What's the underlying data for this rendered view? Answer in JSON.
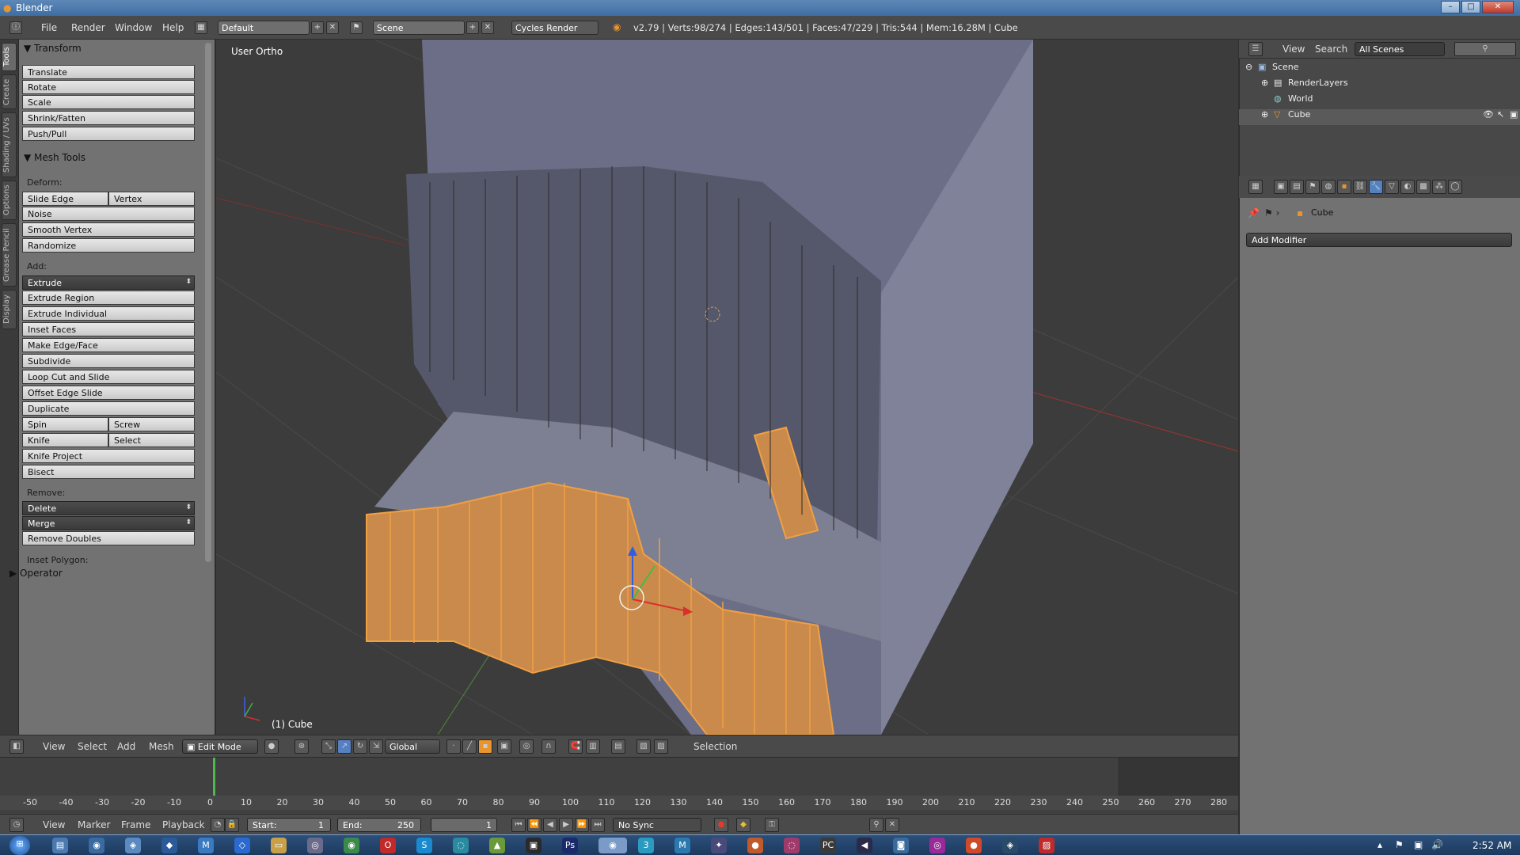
{
  "window": {
    "title": "Blender",
    "min": "–",
    "max": "□",
    "close": "✕"
  },
  "info_bar": {
    "menus": [
      "File",
      "Render",
      "Window",
      "Help"
    ],
    "layout": "Default",
    "scene": "Scene",
    "engine": "Cycles Render",
    "stats": "v2.79 | Verts:98/274 | Edges:143/501 | Faces:47/229 | Tris:544 | Mem:16.28M | Cube"
  },
  "shelf_tabs": [
    "Tools",
    "Create",
    "Shading / UVs",
    "Options",
    "Grease Pencil",
    "Display"
  ],
  "tool_shelf": {
    "transform_title": "Transform",
    "transform": [
      "Translate",
      "Rotate",
      "Scale",
      "Shrink/Fatten",
      "Push/Pull"
    ],
    "mesh_tools_title": "Mesh Tools",
    "deform_label": "Deform:",
    "slide_edge": "Slide Edge",
    "vertex": "Vertex",
    "noise": "Noise",
    "smooth_vertex": "Smooth Vertex",
    "randomize": "Randomize",
    "add_label": "Add:",
    "extrude": "Extrude",
    "add_items": [
      "Extrude Region",
      "Extrude Individual",
      "Inset Faces",
      "Make Edge/Face",
      "Subdivide",
      "Loop Cut and Slide",
      "Offset Edge Slide",
      "Duplicate"
    ],
    "spin": "Spin",
    "screw": "Screw",
    "knife": "Knife",
    "select": "Select",
    "knife_project": "Knife Project",
    "bisect": "Bisect",
    "remove_label": "Remove:",
    "delete": "Delete",
    "merge": "Merge",
    "remove_doubles": "Remove Doubles",
    "inset_polygon": "Inset Polygon:",
    "operator": "Operator"
  },
  "viewport": {
    "view_label": "User Ortho",
    "object_label": "(1) Cube"
  },
  "view3d_header": {
    "menus": [
      "View",
      "Select",
      "Add",
      "Mesh"
    ],
    "mode": "Edit Mode",
    "orientation": "Global",
    "selection": "Selection"
  },
  "timeline": {
    "ticks": [
      "-50",
      "-40",
      "-30",
      "-20",
      "-10",
      "0",
      "10",
      "20",
      "30",
      "40",
      "50",
      "60",
      "70",
      "80",
      "90",
      "100",
      "110",
      "120",
      "130",
      "140",
      "150",
      "160",
      "170",
      "180",
      "190",
      "200",
      "210",
      "220",
      "230",
      "240",
      "250",
      "260",
      "270",
      "280"
    ],
    "menus": [
      "View",
      "Marker",
      "Frame",
      "Playback"
    ],
    "start_label": "Start:",
    "start": "1",
    "end_label": "End:",
    "end": "250",
    "current": "1",
    "sync": "No Sync"
  },
  "outliner": {
    "menus": [
      "View",
      "Search"
    ],
    "filter": "All Scenes",
    "items": [
      "Scene",
      "RenderLayers",
      "World",
      "Cube"
    ]
  },
  "properties": {
    "object": "Cube",
    "add_modifier": "Add Modifier"
  },
  "taskbar": {
    "clock": "2:52 AM"
  },
  "colors": {
    "accent": "#e8942f",
    "selected_face": "#c8894a",
    "axis_x": "#d0312d",
    "axis_y": "#6ab04c"
  }
}
